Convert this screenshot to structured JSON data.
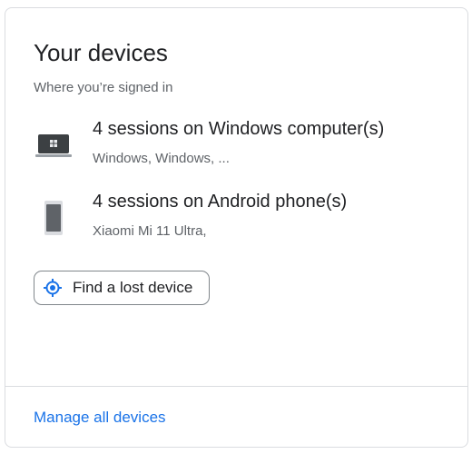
{
  "devices_card": {
    "title": "Your devices",
    "subtitle": "Where you’re signed in",
    "devices": [
      {
        "icon": "laptop-windows-icon",
        "primary": "4 sessions on Windows computer(s)",
        "secondary": "Windows, Windows, ..."
      },
      {
        "icon": "android-phone-icon",
        "primary": "4 sessions on Android phone(s)",
        "secondary": "Xiaomi Mi 11 Ultra,"
      }
    ],
    "find_lost_device_label": "Find a lost device",
    "manage_all_label": "Manage all devices"
  },
  "colors": {
    "accent": "#1a73e8",
    "text_primary": "#202124",
    "text_secondary": "#5f6368",
    "border": "#dadce0"
  }
}
